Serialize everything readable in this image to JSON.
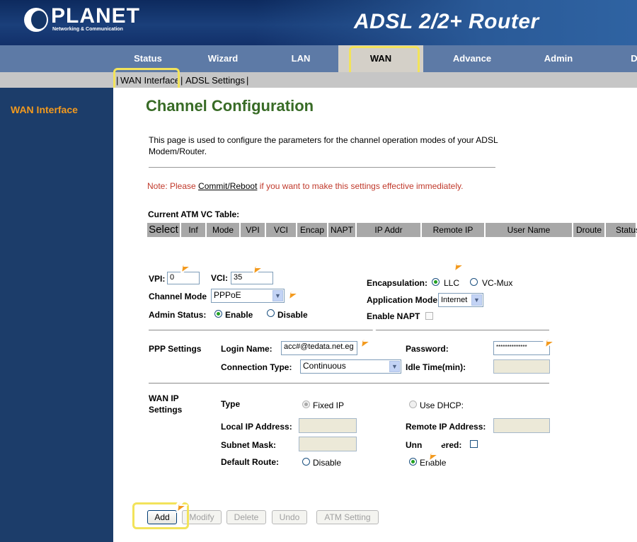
{
  "header": {
    "brand": "PLANET",
    "tagline": "Networking & Communication",
    "product_title": "ADSL 2/2+ Router"
  },
  "nav": {
    "tabs": [
      {
        "label": "Status"
      },
      {
        "label": "Wizard"
      },
      {
        "label": "LAN"
      },
      {
        "label": "WAN"
      },
      {
        "label": "Advance"
      },
      {
        "label": "Admin"
      },
      {
        "label": "D"
      }
    ],
    "active": "WAN"
  },
  "subnav": {
    "items": [
      {
        "label": "WAN Interface"
      },
      {
        "label": "ADSL Settings"
      }
    ],
    "sep": "|"
  },
  "sidebar": {
    "items": [
      {
        "label": "WAN Interface"
      }
    ]
  },
  "page": {
    "title": "Channel Configuration",
    "intro": "This page is used to configure the parameters for the channel operation modes of your ADSL Modem/Router.",
    "note_prefix": "Note: Please ",
    "note_link": "Commit/Reboot",
    "note_suffix": " if you want to make this settings effective immediately."
  },
  "vc_table": {
    "title": "Current ATM VC Table:",
    "columns": [
      "Select",
      "Inf",
      "Mode",
      "VPI",
      "VCI",
      "Encap",
      "NAPT",
      "IP Addr",
      "Remote IP",
      "User Name",
      "Droute",
      "Status"
    ]
  },
  "form": {
    "vpi_label": "VPI:",
    "vpi_value": "0",
    "vci_label": "VCI:",
    "vci_value": "35",
    "channel_mode_label": "Channel Mode",
    "channel_mode_value": "PPPoE",
    "admin_status_label": "Admin Status:",
    "admin_enable": "Enable",
    "admin_disable": "Disable",
    "encapsulation_label": "Encapsulation:",
    "encap_llc": "LLC",
    "encap_vcmux": "VC-Mux",
    "application_mode_label": "Application Mode",
    "application_mode_value": "Internet",
    "enable_napt_label": "Enable NAPT"
  },
  "ppp": {
    "section_label": "PPP Settings",
    "login_label": "Login Name:",
    "login_value": "acc#@tedata.net.eg",
    "password_label": "Password:",
    "password_value": "**************",
    "conn_type_label": "Connection Type:",
    "conn_type_value": "Continuous",
    "idle_label": "Idle Time(min):",
    "idle_value": ""
  },
  "wanip": {
    "section_label_1": "WAN IP",
    "section_label_2": "Settings",
    "type_label": "Type",
    "fixed_ip": "Fixed IP",
    "use_dhcp": "Use DHCP:",
    "local_ip_label": "Local IP Address:",
    "remote_ip_label": "Remote IP Address:",
    "subnet_label": "Subnet Mask:",
    "unnumbered_label": "Unn        ered:",
    "default_route_label": "Default Route:",
    "dr_disable": "Disable",
    "dr_enable": "Enable"
  },
  "buttons": {
    "add": "Add",
    "modify": "Modify",
    "delete": "Delete",
    "undo": "Undo",
    "atm_setting": "ATM Setting"
  },
  "colors": {
    "header_navy": "#0d2a5e",
    "nav_blue": "#5d7aa6",
    "sidebar_navy": "#1c3d6a",
    "sidebar_text": "#f39a1e",
    "title_green": "#386b26",
    "note_red": "#c0392b",
    "highlight_yellow": "#f2e35a",
    "annotation_orange": "#f39a1e"
  }
}
